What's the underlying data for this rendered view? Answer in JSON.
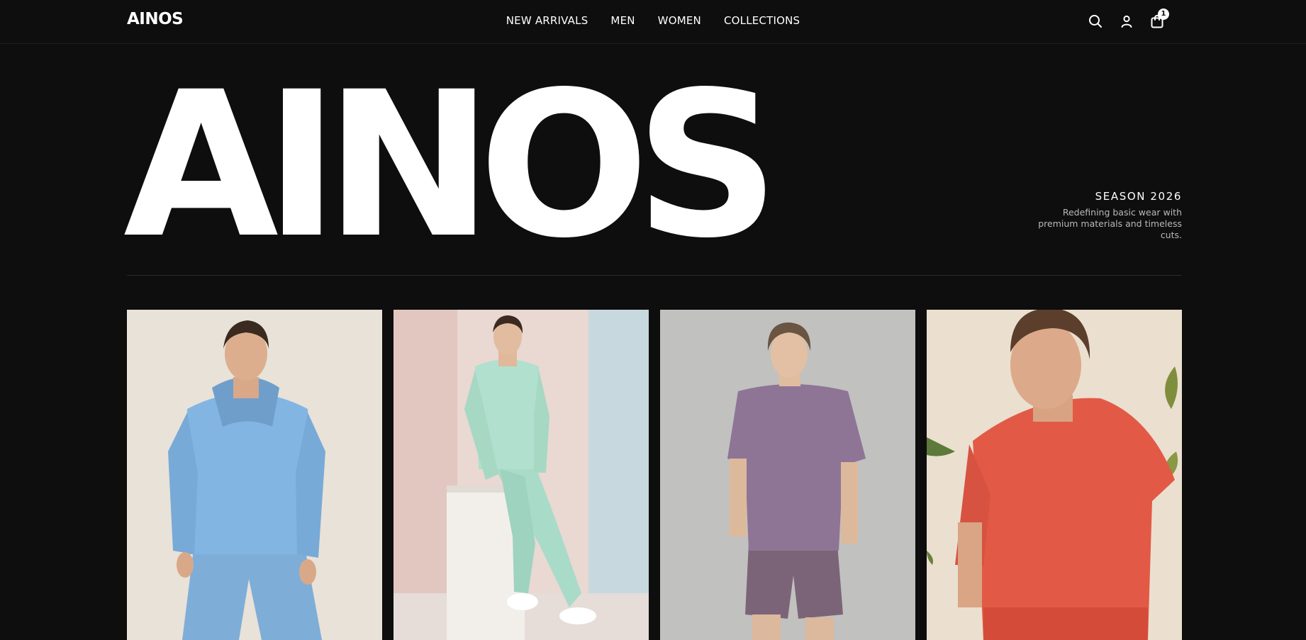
{
  "header": {
    "brand": "AINOS",
    "nav": [
      "NEW ARRIVALS",
      "MEN",
      "WOMEN",
      "COLLECTIONS"
    ],
    "icons": [
      "search-icon",
      "account-icon",
      "shopping-bag-icon"
    ],
    "cart_count": "1"
  },
  "hero": {
    "title": "AINOS",
    "season": "SEASON 2026",
    "tagline": "Redefining basic wear with premium materials and timeless cuts."
  },
  "products": [
    {
      "image": "model-blue-hoodie-shorts"
    },
    {
      "image": "model-mint-sweatsuit"
    },
    {
      "image": "model-purple-tee-shorts"
    },
    {
      "image": "model-red-tee"
    }
  ],
  "colors": {
    "background": "#0e0e0e",
    "text": "#ffffff",
    "muted_text": "#b9b9b9"
  }
}
